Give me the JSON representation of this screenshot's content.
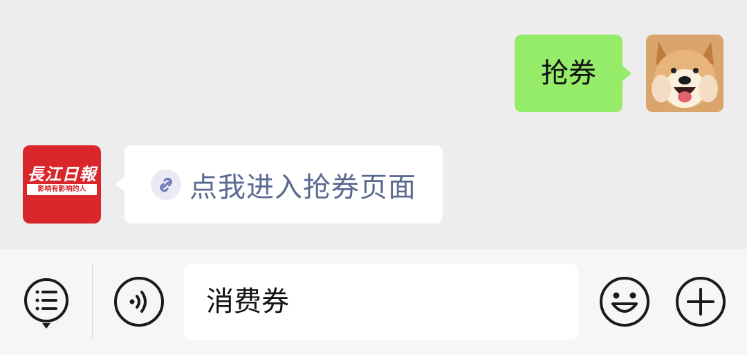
{
  "conversation": {
    "sent_message": {
      "text": "抢券",
      "avatar_icon": "shiba-dog-avatar"
    },
    "received_message": {
      "link_text": "点我进入抢券页面",
      "avatar": {
        "logo_text": "長江日報",
        "slogan": "影响有影响的人"
      }
    }
  },
  "input_bar": {
    "menu_icon": "list-menu-icon",
    "voice_icon": "voice-icon",
    "input_value": "消费券",
    "emoji_icon": "smiley-icon",
    "add_icon": "plus-icon"
  },
  "colors": {
    "sent_bubble": "#95ec69",
    "received_bubble": "#ffffff",
    "link_text": "#5b6a91",
    "brand_red": "#d8262b",
    "background": "#ededed"
  }
}
